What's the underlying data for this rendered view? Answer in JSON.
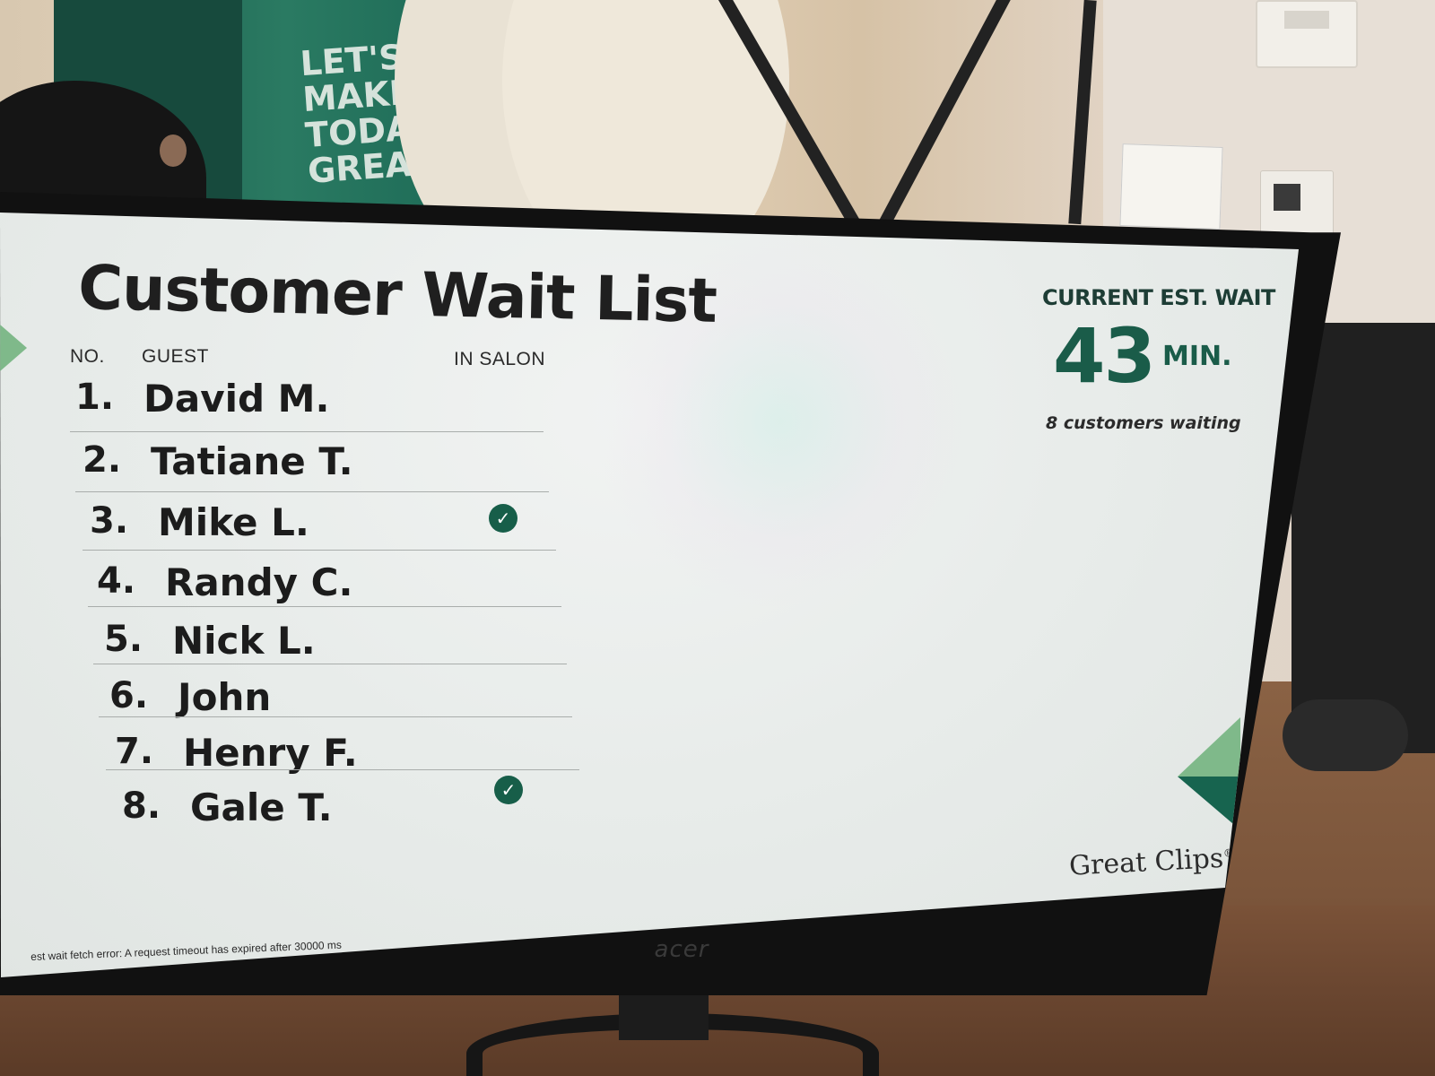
{
  "scene": {
    "wall_sign": "LET'S MAKE TODAY GREAT",
    "monitor_brand": "acer"
  },
  "display": {
    "title": "Customer Wait List",
    "columns": {
      "number": "NO.",
      "guest": "GUEST",
      "in_salon": "IN SALON"
    },
    "guests": [
      {
        "number": "1.",
        "name": "David M.",
        "in_salon": false
      },
      {
        "number": "2.",
        "name": "Tatiane T.",
        "in_salon": false
      },
      {
        "number": "3.",
        "name": "Mike L.",
        "in_salon": true
      },
      {
        "number": "4.",
        "name": "Randy C.",
        "in_salon": false
      },
      {
        "number": "5.",
        "name": "Nick L.",
        "in_salon": false
      },
      {
        "number": "6.",
        "name": "John",
        "in_salon": false
      },
      {
        "number": "7.",
        "name": "Henry F.",
        "in_salon": false
      },
      {
        "number": "8.",
        "name": "Gale T.",
        "in_salon": true
      }
    ],
    "wait": {
      "label": "CURRENT EST. WAIT",
      "minutes": "43",
      "unit": "MIN.",
      "customers_waiting": "8 customers waiting"
    },
    "brand": "Great Clips",
    "brand_mark": "®",
    "error": "est wait fetch error: A request timeout has expired after 30000 ms",
    "check_icon": "check-circle-icon",
    "accent_color": "#175e49"
  }
}
